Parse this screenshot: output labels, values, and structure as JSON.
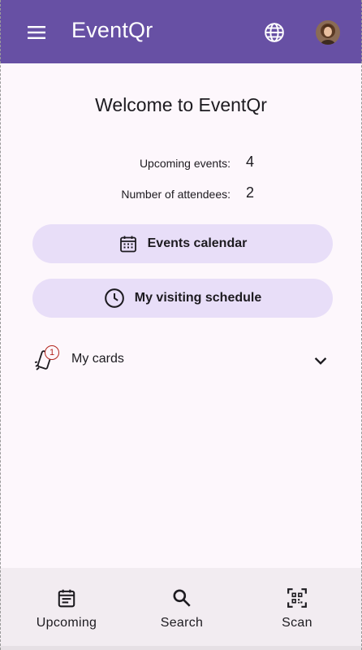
{
  "app_bar": {
    "title": "EventQr",
    "icons": {
      "menu": "menu-icon",
      "language": "globe-icon",
      "avatar": "avatar"
    },
    "color": "#6750a4"
  },
  "main": {
    "welcome": "Welcome to EventQr",
    "stats": [
      {
        "label": "Upcoming events:",
        "value": "4"
      },
      {
        "label": "Number of attendees:",
        "value": "2"
      }
    ],
    "buttons": [
      {
        "label": "Events calendar",
        "icon": "calendar-icon"
      },
      {
        "label": "My visiting schedule",
        "icon": "clock-icon"
      }
    ],
    "cards": {
      "label": "My cards",
      "badge": "1",
      "icon": "cards-icon",
      "expand_icon": "chevron-down-icon"
    }
  },
  "bottom_nav": {
    "items": [
      {
        "label": "Upcoming",
        "icon": "event-list-icon"
      },
      {
        "label": "Search",
        "icon": "search-icon"
      },
      {
        "label": "Scan",
        "icon": "qr-scan-icon"
      }
    ]
  },
  "colors": {
    "primary": "#6750a4",
    "button_bg": "#e8def8",
    "background": "#fdf7fc",
    "nav_bg": "#f2ecf1",
    "badge": "#b3261e"
  }
}
